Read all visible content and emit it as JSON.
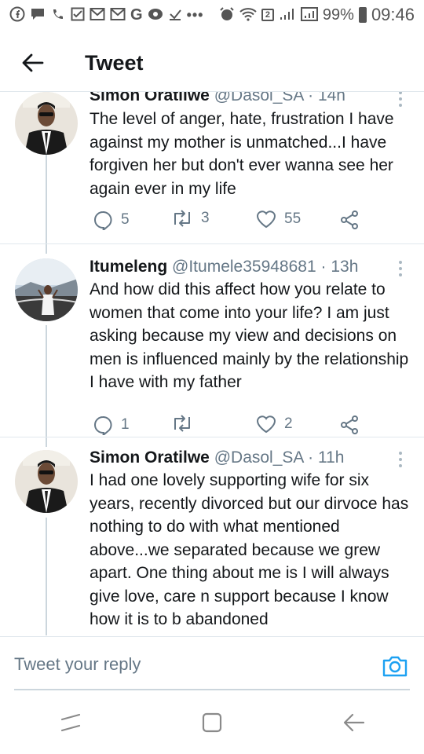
{
  "status_bar": {
    "battery": "99%",
    "time": "09:46",
    "notification_badge": "2",
    "icons": [
      "facebook-icon",
      "chat-icon",
      "missed-call-icon",
      "checkbox-icon",
      "mail-icon",
      "mail-icon",
      "google-icon",
      "record-icon",
      "download-icon",
      "more-dots-icon",
      "alarm-icon",
      "wifi-icon",
      "signal-icon",
      "signal-icon",
      "battery-icon"
    ]
  },
  "header": {
    "title": "Tweet",
    "back_icon": "arrow-left-icon"
  },
  "tweets": [
    {
      "name": "Simon Oratilwe",
      "handle": "@Dasol_SA",
      "separator": "·",
      "time": "14h",
      "text": "The level of anger, hate, frustration I have against my mother is unmatched...I have forgiven her but don't ever wanna see her again ever in my life",
      "replies": "5",
      "retweets": "3",
      "likes": "55"
    },
    {
      "name": "Itumeleng",
      "handle": "@Itumele35948681",
      "separator": "·",
      "time": "13h",
      "text": "And how did this affect how you relate to women that come into your life? I am just asking because my view and decisions on men is influenced mainly by the relationship I have with my father",
      "replies": "1",
      "retweets": "",
      "likes": "2"
    },
    {
      "name": "Simon Oratilwe",
      "handle": "@Dasol_SA",
      "separator": "·",
      "time": "11h",
      "text": "I had one lovely supporting wife for six years, recently divorced but our dirvoce has nothing to do with what mentioned above...we separated because we grew apart. One thing about me is I will always give love, care n support because I know how it is to b abandoned"
    }
  ],
  "reply_bar": {
    "placeholder": "Tweet your reply",
    "camera_icon": "camera-icon"
  },
  "nav_bar": {
    "icons": [
      "recents-icon",
      "home-icon",
      "back-icon"
    ]
  },
  "colors": {
    "accent": "#1da1f2",
    "text": "#14171a",
    "secondary": "#657786",
    "divider": "#e1e8ed"
  }
}
